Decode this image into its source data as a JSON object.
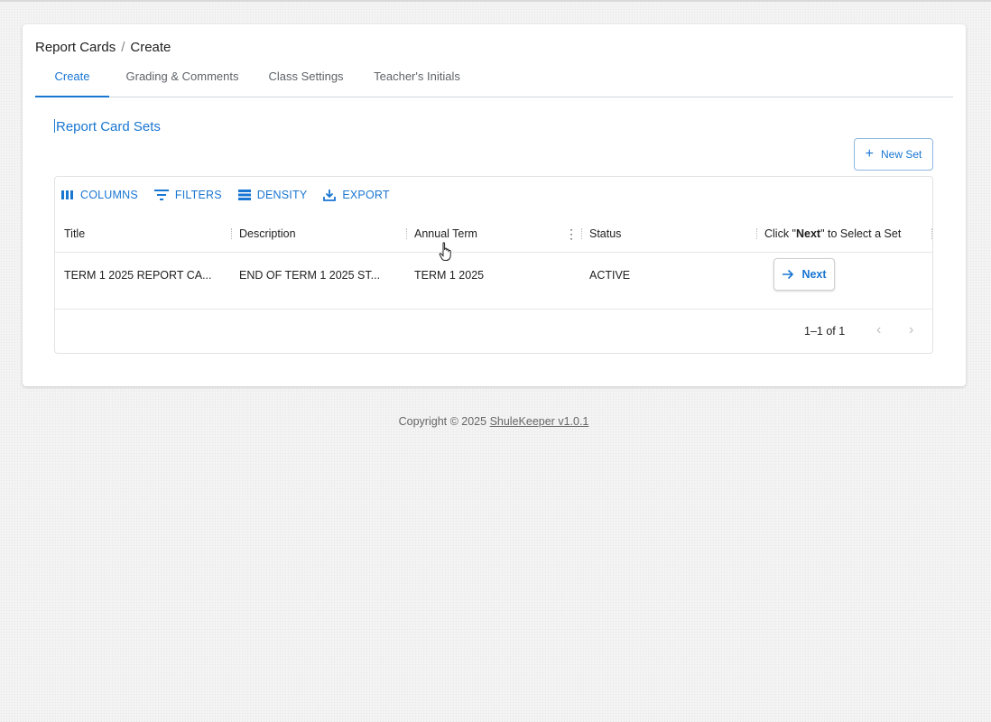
{
  "breadcrumb": {
    "parent": "Report Cards",
    "separator": "/",
    "current": "Create"
  },
  "tabs": [
    {
      "label": "Create",
      "active": true
    },
    {
      "label": "Grading & Comments",
      "active": false
    },
    {
      "label": "Class Settings",
      "active": false
    },
    {
      "label": "Teacher's Initials",
      "active": false
    }
  ],
  "section": {
    "title": "Report Card Sets"
  },
  "new_set_button": {
    "label": "New Set",
    "icon": "plus-icon"
  },
  "toolbar": {
    "columns": "COLUMNS",
    "filters": "FILTERS",
    "density": "DENSITY",
    "export": "EXPORT"
  },
  "table": {
    "headers": {
      "title": "Title",
      "description": "Description",
      "annual_term": "Annual Term",
      "status": "Status",
      "action_prefix": "Click \"",
      "action_bold": "Next",
      "action_suffix": "\" to Select a Set"
    },
    "rows": [
      {
        "title": "TERM 1 2025 REPORT CA...",
        "description": "END OF TERM 1 2025 ST...",
        "annual_term": "TERM 1 2025",
        "status": "ACTIVE",
        "action_label": "Next"
      }
    ],
    "pagination": {
      "range": "1–1 of 1",
      "prev_icon": "chevron-left-icon",
      "next_icon": "chevron-right-icon"
    }
  },
  "footer": {
    "prefix": "Copyright © 2025 ",
    "link": "ShuleKeeper v1.0.1"
  },
  "colors": {
    "accent": "#1976d2",
    "background": "#f3f3f3",
    "card": "#ffffff"
  }
}
